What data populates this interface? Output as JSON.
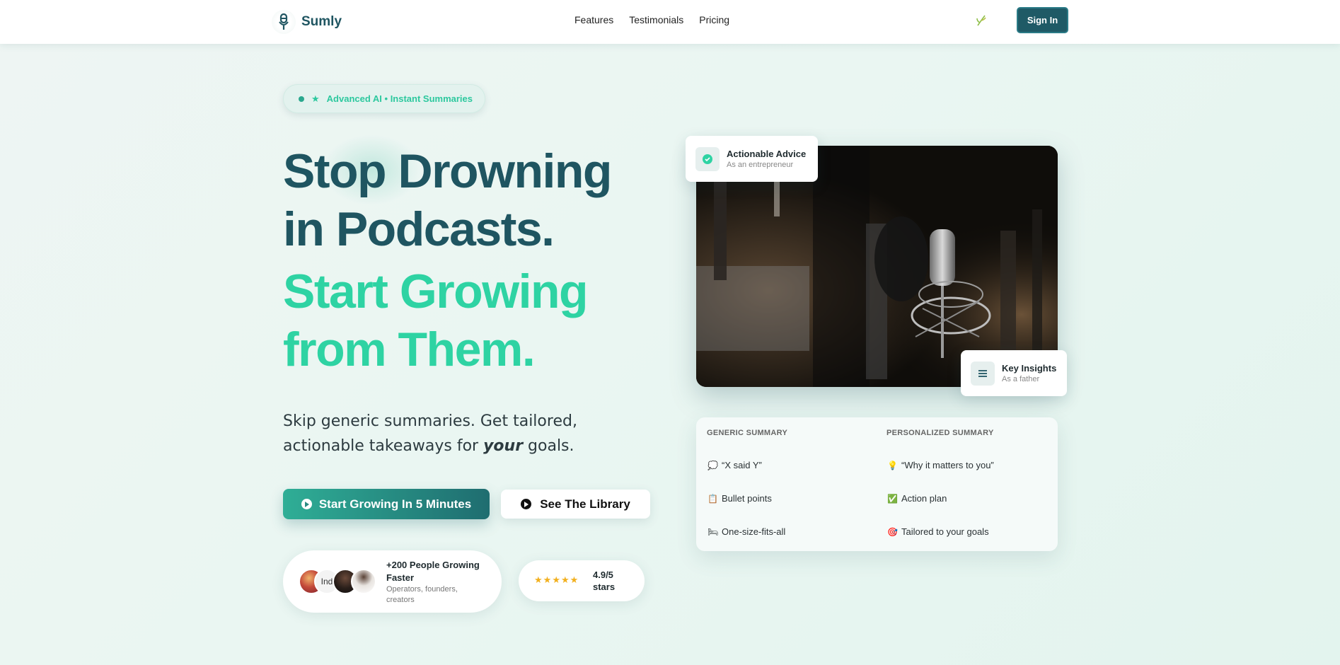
{
  "header": {
    "brand": "Sumly",
    "nav": [
      "Features",
      "Testimonials",
      "Pricing"
    ],
    "sign_in": "Sign In"
  },
  "badge": {
    "text": "Advanced AI • Instant Summaries"
  },
  "hero": {
    "line1": "Stop Drowning",
    "line2": "in Podcasts.",
    "line3": "Start Growing",
    "line4": "from Them.",
    "subtitle_part1": "Skip generic summaries. Get tailored, actionable takeaways for ",
    "subtitle_emph": "your",
    "subtitle_part2": " goals.",
    "cta_primary": "Start Growing In 5 Minutes",
    "cta_secondary": "See The Library"
  },
  "social_proof": {
    "title": "+200 People Growing Faster",
    "subtitle": "Operators, founders, creators",
    "avatar_alt": "Ind"
  },
  "rating": {
    "value": "4.9/5",
    "unit": "stars",
    "stars": 5
  },
  "cards": {
    "advice_title": "Actionable Advice",
    "advice_sub": "As an entrepreneur",
    "insights_title": "Key Insights",
    "insights_sub": "As a father"
  },
  "comparison": {
    "generic_header": "GENERIC SUMMARY",
    "personalized_header": "PERSONALIZED SUMMARY",
    "generic": [
      {
        "emoji": "💭",
        "text": "“X said Y”"
      },
      {
        "emoji": "📋",
        "text": "Bullet points"
      },
      {
        "emoji": "🛏",
        "text": "One-size-fits-all"
      }
    ],
    "personalized": [
      {
        "emoji": "💡",
        "text": "“Why it matters to you”"
      },
      {
        "emoji": "✅",
        "text": "Action plan"
      },
      {
        "emoji": "🎯",
        "text": "Tailored to your goals"
      }
    ]
  },
  "colors": {
    "brand_dark": "#1f5561",
    "brand_green": "#2ed3a3",
    "button_dark": "#1f5a66",
    "star": "#f2b01e"
  }
}
